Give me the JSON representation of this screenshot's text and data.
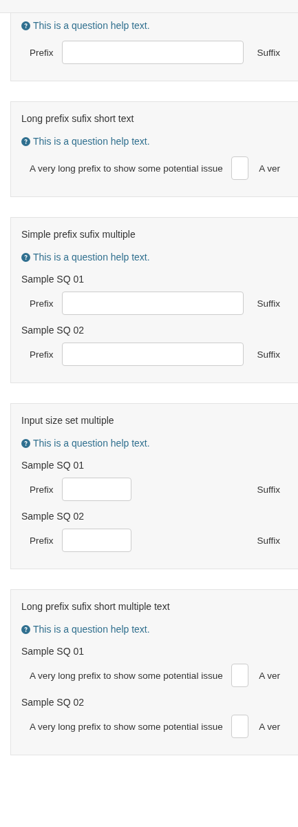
{
  "questions": [
    {
      "help": "This is a question help text.",
      "kind": "wide",
      "rows": [
        {
          "prefix": "Prefix",
          "suffix": "Suffix"
        }
      ]
    },
    {
      "title": "Long prefix sufix short text",
      "help": "This is a question help text.",
      "kind": "tiny",
      "rows": [
        {
          "prefix": "A very long prefix to show some potential issue",
          "suffix": "A ver"
        }
      ]
    },
    {
      "title": "Simple prefix sufix multiple",
      "help": "This is a question help text.",
      "kind": "wide",
      "rows": [
        {
          "label": "Sample SQ 01",
          "prefix": "Prefix",
          "suffix": "Suffix"
        },
        {
          "label": "Sample SQ 02",
          "prefix": "Prefix",
          "suffix": "Suffix"
        }
      ]
    },
    {
      "title": "Input size set multiple",
      "help": "This is a question help text.",
      "kind": "small",
      "rows": [
        {
          "label": "Sample SQ 01",
          "prefix": "Prefix",
          "suffix": "Suffix"
        },
        {
          "label": "Sample SQ 02",
          "prefix": "Prefix",
          "suffix": "Suffix"
        }
      ]
    },
    {
      "title": "Long prefix sufix short multiple text",
      "help": "This is a question help text.",
      "kind": "tiny",
      "rows": [
        {
          "label": "Sample SQ 01",
          "prefix": "A very long prefix to show some potential issue",
          "suffix": "A ver"
        },
        {
          "label": "Sample SQ 02",
          "prefix": "A very long prefix to show some potential issue",
          "suffix": "A ver"
        }
      ]
    }
  ]
}
